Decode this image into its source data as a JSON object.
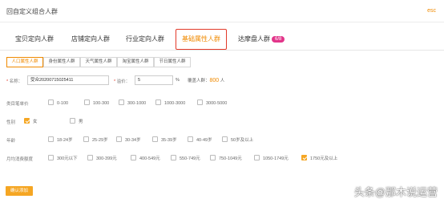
{
  "header": {
    "title": "回自定义组合人群",
    "close": "esc"
  },
  "main_tabs": [
    {
      "label": "宝贝定向人群"
    },
    {
      "label": "店铺定向人群"
    },
    {
      "label": "行业定向人群"
    },
    {
      "label": "基础属性人群",
      "active": true
    },
    {
      "label": "达摩盘人群",
      "badge": "6/8"
    }
  ],
  "sub_tabs": [
    {
      "label": "人口属性人群",
      "active": true
    },
    {
      "label": "身份属性人群"
    },
    {
      "label": "天气属性人群"
    },
    {
      "label": "淘宝属性人群"
    },
    {
      "label": "节日属性人群"
    }
  ],
  "form": {
    "name_label": "名称：",
    "name_value": "受众20200715025411",
    "premium_label": "溢价：",
    "premium_value": "5",
    "premium_unit": "%",
    "covered_label": "覆盖人群：",
    "covered_value": "800",
    "covered_unit": "人"
  },
  "filters": {
    "category_price": {
      "label": "类目笔单价",
      "options": [
        {
          "label": "0-100"
        },
        {
          "label": "100-300"
        },
        {
          "label": "300-1000"
        },
        {
          "label": "1000-3000"
        },
        {
          "label": "3000-5000"
        }
      ]
    },
    "gender": {
      "label": "性别",
      "options": [
        {
          "label": "女",
          "checked": true
        },
        {
          "label": "男"
        }
      ]
    },
    "age": {
      "label": "年龄",
      "options": [
        {
          "label": "18-24岁"
        },
        {
          "label": "25-29岁"
        },
        {
          "label": "30-34岁"
        },
        {
          "label": "35-39岁"
        },
        {
          "label": "40-49岁"
        },
        {
          "label": "50岁及以上"
        }
      ]
    },
    "monthly_spend": {
      "label": "月均消费额度",
      "options": [
        {
          "label": "300元以下"
        },
        {
          "label": "300-399元"
        },
        {
          "label": "400-549元"
        },
        {
          "label": "550-749元"
        },
        {
          "label": "750-1049元"
        },
        {
          "label": "1050-1749元"
        },
        {
          "label": "1750元及以上",
          "checked": true
        }
      ]
    }
  },
  "confirm_button": "确认添加",
  "watermark": "头条@那木说运营",
  "colors": {
    "accent": "#f08a00",
    "active_border": "#e23a2a",
    "badge": "#e2358a",
    "checkbox": "#f5a623"
  }
}
